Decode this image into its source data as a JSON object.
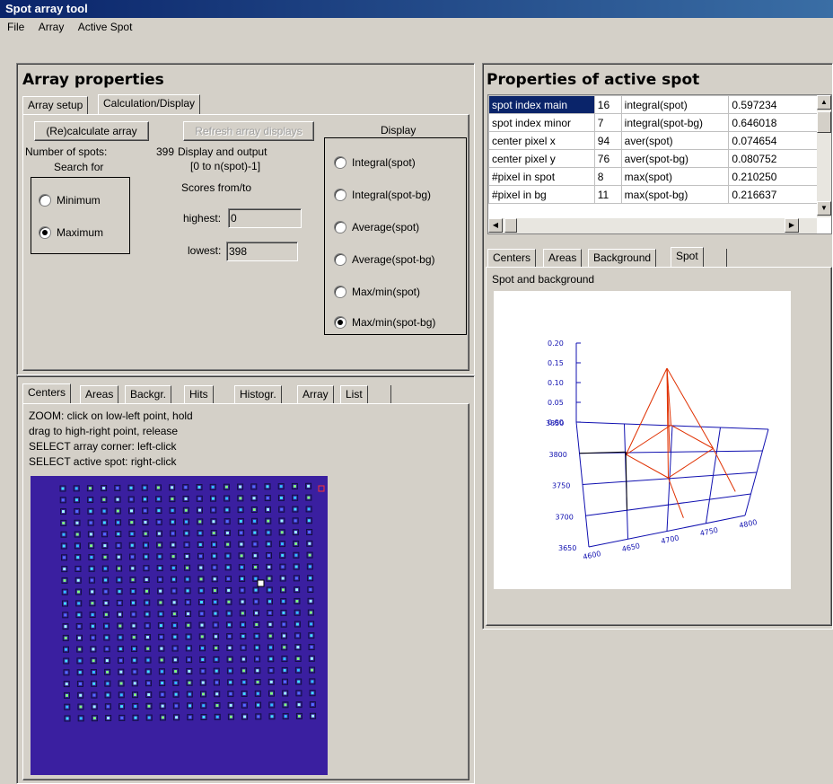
{
  "window": {
    "title": "Spot array tool"
  },
  "menu": [
    "File",
    "Array",
    "Active Spot"
  ],
  "array_properties": {
    "title": "Array properties",
    "tabs": [
      "Array setup",
      "Calculation/Display"
    ],
    "recalc_label": "(Re)calculate array",
    "refresh_label": "Refresh array displays",
    "num_spots_label": "Number of spots:",
    "num_spots_value": "399",
    "display_output_label": "Display and output",
    "range_label": "[0 to n(spot)-1]",
    "scores_label": "Scores from/to",
    "search_for_label": "Search for",
    "search_options": [
      "Minimum",
      "Maximum"
    ],
    "search_selected": "Maximum",
    "highest_label": "highest:",
    "highest_value": "0",
    "lowest_label": "lowest:",
    "lowest_value": "398",
    "display_label": "Display",
    "display_options": [
      "Integral(spot)",
      "Integral(spot-bg)",
      "Average(spot)",
      "Average(spot-bg)",
      "Max/min(spot)",
      "Max/min(spot-bg)"
    ],
    "display_selected": "Max/min(spot-bg)"
  },
  "bottom_left": {
    "tabs": [
      "Centers",
      "Areas",
      "Backgr.",
      "Hits",
      "Histogr.",
      "Array",
      "List"
    ],
    "instructions": [
      "ZOOM: click on low-left point, hold",
      "drag to high-right point, release",
      "SELECT array corner: left-click",
      "SELECT active spot: right-click"
    ]
  },
  "active_spot": {
    "title": "Properties of active spot",
    "rows": [
      [
        "spot index main",
        "16",
        "integral(spot)",
        "0.597234"
      ],
      [
        "spot index minor",
        "7",
        "integral(spot-bg)",
        "0.646018"
      ],
      [
        "center pixel x",
        "94",
        "aver(spot)",
        "0.074654"
      ],
      [
        "center pixel y",
        "76",
        "aver(spot-bg)",
        "0.080752"
      ],
      [
        "#pixel in spot",
        "8",
        "max(spot)",
        "0.210250"
      ],
      [
        "#pixel in bg",
        "11",
        "max(spot-bg)",
        "0.216637"
      ]
    ],
    "tabs": [
      "Centers",
      "Areas",
      "Background",
      "Spot"
    ],
    "plot_label": "Spot and background",
    "plot": {
      "z_ticks": [
        "0.20",
        "0.15",
        "0.10",
        "0.05",
        "0.00"
      ],
      "y_ticks": [
        "3850",
        "3800",
        "3750",
        "3700",
        "3650"
      ],
      "x_ticks": [
        "4600",
        "4650",
        "4700",
        "4750",
        "4800"
      ]
    }
  },
  "colors": {
    "title_start": "#0a246a",
    "title_end": "#3a6ea5",
    "selection": "#0a246a",
    "image_bg": "#3a1fa0",
    "plot_axis": "#1010b0",
    "spot_line": "#e03000"
  }
}
